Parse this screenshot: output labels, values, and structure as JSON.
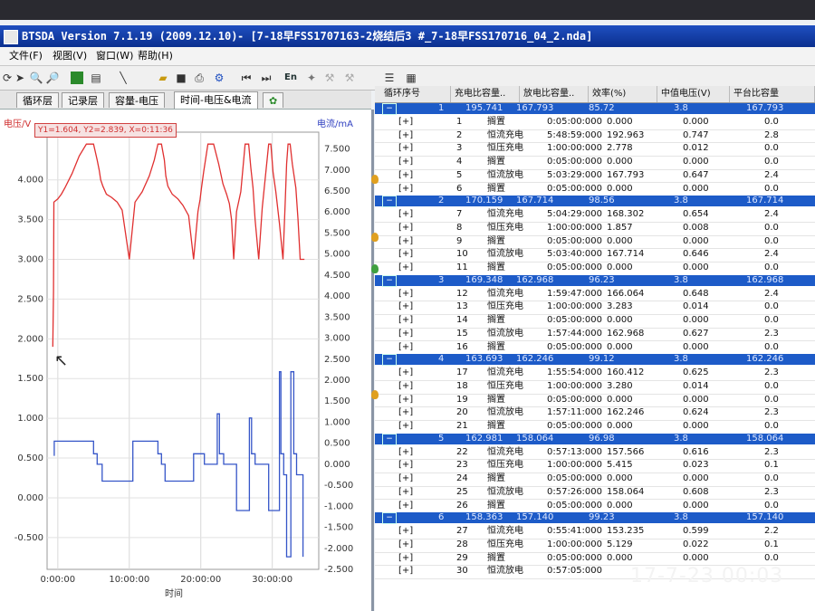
{
  "window": {
    "app_title": "BTSDA Version 7.1.19 (2009.12.10)",
    "doc_title": "- [7-18早FSS1707163-2烧结后3 #_7-18早FSS170716_04_2.nda]"
  },
  "menu": [
    "文件(F)",
    "视图(V)",
    "窗口(W)",
    "帮助(H)"
  ],
  "toolbar": {
    "lang_label": "En"
  },
  "tabs": [
    "循环层",
    "记录层",
    "容量-电压",
    "时间-电压&电流"
  ],
  "active_tab": 3,
  "chart": {
    "cursor_readout": "Y1=1.604, Y2=2.839, X=0:11:36",
    "left_axis_label": "电压/V",
    "right_axis_label": "电流/mA",
    "x_axis_label": "时间"
  },
  "chart_data": {
    "type": "line",
    "xlabel": "时间",
    "ylabel": "电压/V",
    "y2label": "电流/mA",
    "x_ticks": [
      "0:00:00",
      "10:00:00",
      "20:00:00",
      "30:00:00"
    ],
    "y_ticks": [
      "4.000",
      "3.500",
      "3.000",
      "2.500",
      "2.000",
      "1.500",
      "1.000",
      "0.500",
      "0.000",
      "-0.500"
    ],
    "y2_ticks": [
      "7.500",
      "7.000",
      "6.500",
      "6.000",
      "5.500",
      "5.000",
      "4.500",
      "4.000",
      "3.500",
      "3.000",
      "2.500",
      "2.000",
      "1.500",
      "1.000",
      "0.500",
      "0.000",
      "-0.500",
      "-1.000",
      "-1.500",
      "-2.000",
      "-2.500"
    ],
    "xlim_hours": [
      -1.5,
      36.5
    ],
    "ylim": [
      -0.9,
      4.6
    ],
    "y2lim": [
      -2.5,
      7.9
    ],
    "grid": true,
    "series": [
      {
        "name": "电压/V",
        "color": "#e03030",
        "axis": "left",
        "x": [
          -0.7,
          -0.6,
          -0.55,
          0.0,
          0.5,
          1.0,
          2.0,
          3.0,
          4.0,
          5.0,
          5.5,
          5.8,
          6.0,
          6.3,
          6.8,
          7.5,
          8.3,
          9.0,
          10.0,
          10.8,
          11.8,
          12.8,
          13.5,
          14.0,
          14.5,
          14.9,
          15.1,
          15.4,
          16.0,
          16.8,
          17.5,
          18.3,
          19.0,
          19.6,
          19.9,
          20.1,
          20.4,
          21.0,
          21.8,
          22.5,
          23.1,
          23.6,
          24.0,
          24.3,
          24.6,
          25.0,
          25.6,
          26.2,
          26.7,
          27.0,
          27.3,
          27.6,
          28.1,
          28.6,
          29.1,
          29.5,
          29.8,
          30.1,
          30.5,
          31.0,
          31.5,
          31.8,
          32.0,
          32.2,
          32.5,
          32.8,
          33.3,
          33.6,
          33.9,
          34.2,
          34.5,
          34.5
        ],
        "y": [
          1.9,
          2.6,
          3.72,
          3.76,
          3.82,
          3.9,
          4.08,
          4.3,
          4.45,
          4.45,
          4.25,
          4.12,
          4.0,
          3.92,
          3.82,
          3.78,
          3.72,
          3.62,
          3.0,
          3.72,
          3.85,
          4.05,
          4.25,
          4.45,
          4.45,
          4.25,
          4.05,
          3.92,
          3.82,
          3.76,
          3.68,
          3.55,
          3.0,
          3.6,
          3.75,
          3.9,
          4.1,
          4.45,
          4.45,
          4.2,
          3.95,
          3.82,
          3.7,
          3.5,
          3.0,
          3.6,
          3.85,
          4.45,
          4.45,
          4.15,
          3.9,
          3.5,
          3.0,
          3.65,
          4.1,
          4.45,
          4.45,
          4.1,
          3.85,
          3.45,
          3.0,
          3.7,
          4.2,
          4.45,
          4.45,
          4.2,
          3.9,
          3.5,
          3.0,
          3.0,
          3.0,
          3.0
        ]
      },
      {
        "name": "电流/mA",
        "color": "#3555c8",
        "axis": "right",
        "x": [
          -0.5,
          -0.5,
          5.0,
          5.0,
          5.5,
          5.5,
          6.2,
          6.2,
          10.5,
          10.5,
          14.0,
          14.0,
          14.5,
          14.5,
          15.0,
          15.0,
          19.0,
          19.0,
          20.5,
          20.5,
          22.3,
          22.3,
          22.6,
          22.6,
          23.2,
          23.2,
          25.0,
          25.0,
          26.8,
          26.8,
          27.1,
          27.1,
          27.6,
          27.6,
          29.5,
          29.5,
          31.0,
          31.0,
          31.2,
          31.2,
          31.6,
          31.6,
          32.0,
          32.0,
          32.6,
          32.6,
          33.0,
          33.0,
          33.4,
          33.4,
          34.3,
          34.3
        ],
        "y": [
          0.2,
          0.55,
          0.55,
          0.25,
          0.25,
          0.0,
          0.0,
          -0.4,
          -0.4,
          0.55,
          0.55,
          0.25,
          0.25,
          0.0,
          0.0,
          -0.4,
          -0.4,
          0.25,
          0.25,
          0.0,
          0.0,
          1.2,
          1.2,
          0.25,
          0.25,
          0.0,
          0.0,
          -1.1,
          -1.1,
          1.1,
          1.1,
          0.25,
          0.25,
          0.0,
          0.0,
          -1.1,
          -1.1,
          2.2,
          2.2,
          0.25,
          0.25,
          -0.25,
          -0.25,
          -2.2,
          -2.2,
          2.2,
          2.2,
          0.25,
          0.25,
          -0.25,
          -0.25,
          -2.2
        ]
      }
    ]
  },
  "table": {
    "columns": [
      "循环序号",
      "充电比容量..",
      "放电比容量..",
      "效率(%)",
      "中值电压(V)",
      "平台比容量"
    ],
    "groups": [
      {
        "summary": [
          "1",
          "195.741",
          "167.793",
          "85.72",
          "3.8",
          "167.793"
        ],
        "rows": [
          [
            "[+]",
            "1",
            "搁置",
            "0:05:00:000",
            "0.000",
            "0.000",
            "0.0"
          ],
          [
            "[+]",
            "2",
            "恒流充电",
            "5:48:59:000",
            "192.963",
            "0.747",
            "2.8"
          ],
          [
            "[+]",
            "3",
            "恒压充电",
            "1:00:00:000",
            "2.778",
            "0.012",
            "0.0"
          ],
          [
            "[+]",
            "4",
            "搁置",
            "0:05:00:000",
            "0.000",
            "0.000",
            "0.0"
          ],
          [
            "[+]",
            "5",
            "恒流放电",
            "5:03:29:000",
            "167.793",
            "0.647",
            "2.4"
          ],
          [
            "[+]",
            "6",
            "搁置",
            "0:05:00:000",
            "0.000",
            "0.000",
            "0.0"
          ]
        ]
      },
      {
        "summary": [
          "2",
          "170.159",
          "167.714",
          "98.56",
          "3.8",
          "167.714"
        ],
        "rows": [
          [
            "[+]",
            "7",
            "恒流充电",
            "5:04:29:000",
            "168.302",
            "0.654",
            "2.4"
          ],
          [
            "[+]",
            "8",
            "恒压充电",
            "1:00:00:000",
            "1.857",
            "0.008",
            "0.0"
          ],
          [
            "[+]",
            "9",
            "搁置",
            "0:05:00:000",
            "0.000",
            "0.000",
            "0.0"
          ],
          [
            "[+]",
            "10",
            "恒流放电",
            "5:03:40:000",
            "167.714",
            "0.646",
            "2.4"
          ],
          [
            "[+]",
            "11",
            "搁置",
            "0:05:00:000",
            "0.000",
            "0.000",
            "0.0"
          ]
        ]
      },
      {
        "summary": [
          "3",
          "169.348",
          "162.968",
          "96.23",
          "3.8",
          "162.968"
        ],
        "rows": [
          [
            "[+]",
            "12",
            "恒流充电",
            "1:59:47:000",
            "166.064",
            "0.648",
            "2.4"
          ],
          [
            "[+]",
            "13",
            "恒压充电",
            "1:00:00:000",
            "3.283",
            "0.014",
            "0.0"
          ],
          [
            "[+]",
            "14",
            "搁置",
            "0:05:00:000",
            "0.000",
            "0.000",
            "0.0"
          ],
          [
            "[+]",
            "15",
            "恒流放电",
            "1:57:44:000",
            "162.968",
            "0.627",
            "2.3"
          ],
          [
            "[+]",
            "16",
            "搁置",
            "0:05:00:000",
            "0.000",
            "0.000",
            "0.0"
          ]
        ]
      },
      {
        "summary": [
          "4",
          "163.693",
          "162.246",
          "99.12",
          "3.8",
          "162.246"
        ],
        "rows": [
          [
            "[+]",
            "17",
            "恒流充电",
            "1:55:54:000",
            "160.412",
            "0.625",
            "2.3"
          ],
          [
            "[+]",
            "18",
            "恒压充电",
            "1:00:00:000",
            "3.280",
            "0.014",
            "0.0"
          ],
          [
            "[+]",
            "19",
            "搁置",
            "0:05:00:000",
            "0.000",
            "0.000",
            "0.0"
          ],
          [
            "[+]",
            "20",
            "恒流放电",
            "1:57:11:000",
            "162.246",
            "0.624",
            "2.3"
          ],
          [
            "[+]",
            "21",
            "搁置",
            "0:05:00:000",
            "0.000",
            "0.000",
            "0.0"
          ]
        ]
      },
      {
        "summary": [
          "5",
          "162.981",
          "158.064",
          "96.98",
          "3.8",
          "158.064"
        ],
        "rows": [
          [
            "[+]",
            "22",
            "恒流充电",
            "0:57:13:000",
            "157.566",
            "0.616",
            "2.3"
          ],
          [
            "[+]",
            "23",
            "恒压充电",
            "1:00:00:000",
            "5.415",
            "0.023",
            "0.1"
          ],
          [
            "[+]",
            "24",
            "搁置",
            "0:05:00:000",
            "0.000",
            "0.000",
            "0.0"
          ],
          [
            "[+]",
            "25",
            "恒流放电",
            "0:57:26:000",
            "158.064",
            "0.608",
            "2.3"
          ],
          [
            "[+]",
            "26",
            "搁置",
            "0:05:00:000",
            "0.000",
            "0.000",
            "0.0"
          ]
        ]
      },
      {
        "summary": [
          "6",
          "158.363",
          "157.140",
          "99.23",
          "3.8",
          "157.140"
        ],
        "rows": [
          [
            "[+]",
            "27",
            "恒流充电",
            "0:55:41:000",
            "153.235",
            "0.599",
            "2.2"
          ],
          [
            "[+]",
            "28",
            "恒压充电",
            "1:00:00:000",
            "5.129",
            "0.022",
            "0.1"
          ],
          [
            "[+]",
            "29",
            "搁置",
            "0:05:00:000",
            "0.000",
            "0.000",
            "0.0"
          ],
          [
            "[+]",
            "30",
            "恒流放电",
            "0:57:05:000",
            "",
            "",
            ""
          ]
        ]
      }
    ]
  },
  "photo_timestamp": "17-7-23 00:03",
  "colors": {
    "titlebar": "#0b2f8f",
    "group_row": "#1d5bc8",
    "voltage": "#e03030",
    "current": "#3555c8"
  }
}
